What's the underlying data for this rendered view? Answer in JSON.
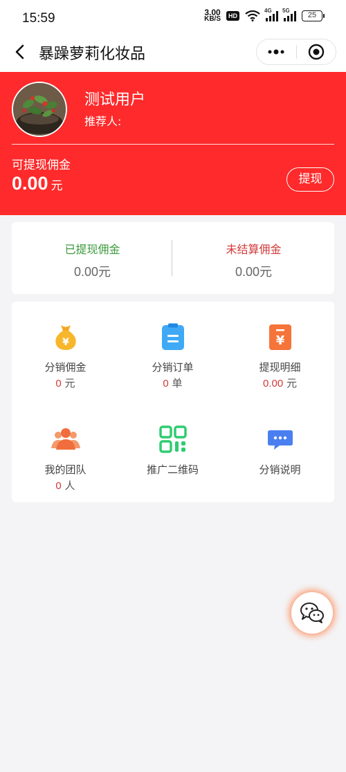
{
  "status_bar": {
    "time": "15:59",
    "net_speed_value": "3.00",
    "net_speed_unit": "KB/S",
    "hd": "HD",
    "sim1": "4G",
    "sim2": "5G",
    "battery": "25"
  },
  "navbar": {
    "title": "暴躁萝莉化妆品"
  },
  "profile": {
    "name": "测试用户",
    "referrer_label": "推荐人:",
    "withdrawable_label": "可提现佣金",
    "withdrawable_amount": "0.00",
    "withdrawable_unit": "元",
    "withdraw_button": "提现"
  },
  "stats": [
    {
      "label": "已提现佣金",
      "value": "0.00元",
      "color": "#3b9a3b"
    },
    {
      "label": "未结算佣金",
      "value": "0.00元",
      "color": "#d23a3a"
    }
  ],
  "grid": [
    {
      "label": "分销佣金",
      "num": "0",
      "unit": "元",
      "icon": "money-bag-icon"
    },
    {
      "label": "分销订单",
      "num": "0",
      "unit": "单",
      "icon": "clipboard-icon"
    },
    {
      "label": "提现明细",
      "num": "0.00",
      "unit": "元",
      "icon": "receipt-icon"
    },
    {
      "label": "我的团队",
      "num": "0",
      "unit": "人",
      "icon": "team-icon"
    },
    {
      "label": "推广二维码",
      "icon": "qr-code-icon"
    },
    {
      "label": "分销说明",
      "icon": "chat-bubble-icon"
    }
  ],
  "colors": {
    "brand_red": "#fe2a2b",
    "green": "#3b9a3b",
    "value_red": "#d23a3a"
  }
}
